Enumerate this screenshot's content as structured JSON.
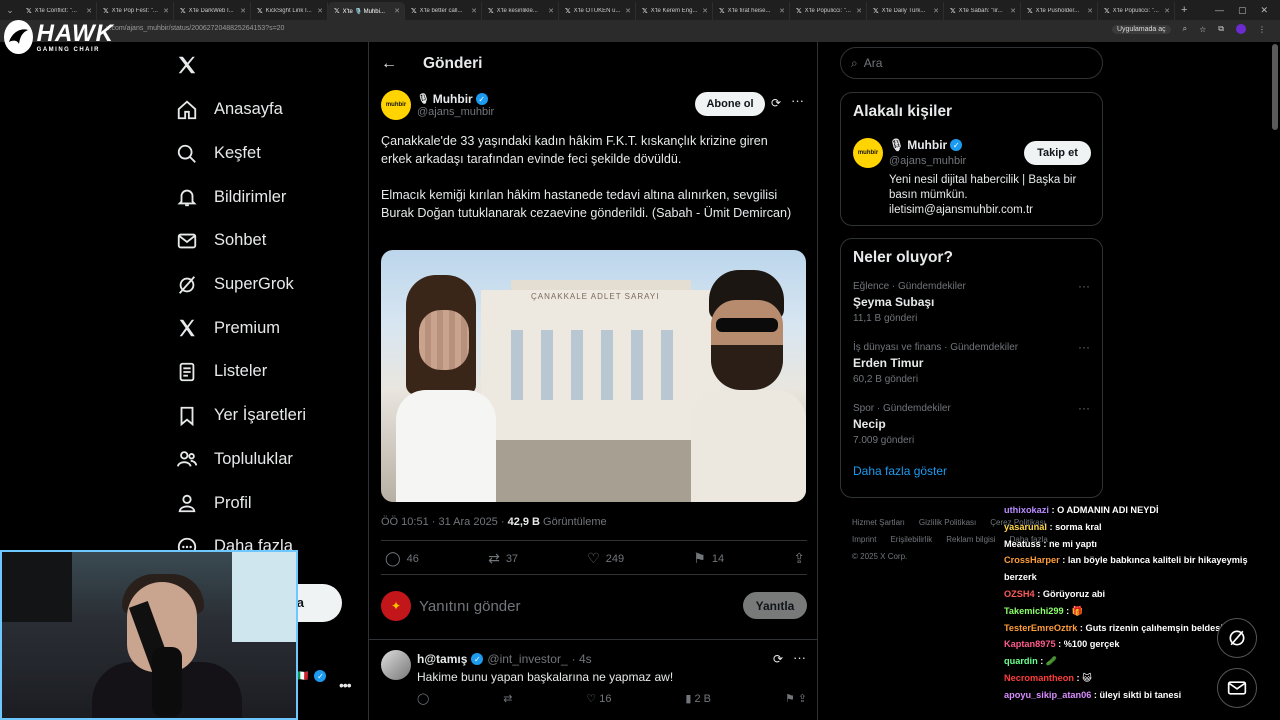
{
  "browser": {
    "tabs": [
      {
        "title": "X'te Conflict: \"..."
      },
      {
        "title": "X'te Pop Fest: \"..."
      },
      {
        "title": "X'te DarkWeb I..."
      },
      {
        "title": "KickSight Link I..."
      },
      {
        "title": "X'te 🎙️ Muhbi...",
        "active": true
      },
      {
        "title": "X'te better call..."
      },
      {
        "title": "X'te kesinlikle..."
      },
      {
        "title": "X'te OTUKEN u..."
      },
      {
        "title": "X'te Kerem Eng..."
      },
      {
        "title": "X'te firat heise..."
      },
      {
        "title": "X'te Populicci: \"..."
      },
      {
        "title": "X'te Daily Türk..."
      },
      {
        "title": "X'te Sabah: \"lir..."
      },
      {
        "title": "X'te Pusholder..."
      },
      {
        "title": "X'te Populicci: \"..."
      }
    ],
    "url": "x.com/ajans_muhbir/status/2006272048825264153?s=20",
    "app_pill": "Uygulamada aç",
    "accent": "#1d9bf0"
  },
  "overlay_logo": {
    "big": "HAWK",
    "small": "GAMING CHAIR"
  },
  "nav": {
    "items": [
      {
        "label": "Anasayfa",
        "icon": "home-icon"
      },
      {
        "label": "Keşfet",
        "icon": "search-icon"
      },
      {
        "label": "Bildirimler",
        "icon": "bell-icon"
      },
      {
        "label": "Sohbet",
        "icon": "mail-icon"
      },
      {
        "label": "SuperGrok",
        "icon": "grok-icon"
      },
      {
        "label": "Premium",
        "icon": "x-icon"
      },
      {
        "label": "Listeler",
        "icon": "list-icon"
      },
      {
        "label": "Yer İşaretleri",
        "icon": "bookmark-icon"
      },
      {
        "label": "Topluluklar",
        "icon": "people-icon"
      },
      {
        "label": "Profil",
        "icon": "person-icon"
      },
      {
        "label": "Daha fazla",
        "icon": "more-icon"
      }
    ],
    "post_button_partial": "a"
  },
  "header": {
    "title": "Gönderi"
  },
  "tweet": {
    "author_name": "Muhbir",
    "author_handle": "@ajans_muhbir",
    "avatar_text": "muhbir",
    "subscribe_label": "Abone ol",
    "text": "Çanakkale'de 33 yaşındaki kadın hâkim F.K.T. kıskançlık krizine giren erkek arkadaşı tarafından evinde feci şekilde dövüldü.\n\nElmacık kemiği kırılan hâkim hastanede tedavi altına alınırken, sevgilisi Burak Doğan tutuklanarak cezaevine gönderildi. (Sabah - Ümit Demircan)",
    "image_sign": "ÇANAKKALE ADLET SARAYI",
    "time": "ÖÖ 10:51 · 31 Ara 2025 · ",
    "views_value": "42,9 B",
    "views_label": " Görüntüleme",
    "counts": {
      "replies": "46",
      "reposts": "37",
      "likes": "249",
      "bookmarks": "14"
    }
  },
  "reply_box": {
    "placeholder": "Yanıtını gönder",
    "button": "Yanıtla"
  },
  "reply_tweet": {
    "name": "h@tamış",
    "handle": "@int_investor_",
    "time": "· 4s",
    "text": "Hakime bunu yapan başkalarına ne yapmaz aw!",
    "likes": "16",
    "views": "2 B"
  },
  "right": {
    "search_placeholder": "Ara",
    "related_title": "Alakalı kişiler",
    "related_person": {
      "name": "Muhbir",
      "handle": "@ajans_muhbir",
      "bio": "Yeni nesil dijital habercilik | Başka bir basın mümkün. iletisim@ajansmuhbir.com.tr",
      "follow_label": "Takip et"
    },
    "trends_title": "Neler oluyor?",
    "trends": [
      {
        "category": "Eğlence · Gündemdekiler",
        "name": "Şeyma Subaşı",
        "count": "11,1 B gönderi"
      },
      {
        "category": "İş dünyası ve finans · Gündemdekiler",
        "name": "Erden Timur",
        "count": "60,2 B gönderi"
      },
      {
        "category": "Spor · Gündemdekiler",
        "name": "Necip",
        "count": "7.009 gönderi"
      }
    ],
    "show_more": "Daha fazla göster",
    "footer": [
      "Hizmet Şartları",
      "Gizlilik Politikası",
      "Çerez Politikası",
      "Imprint",
      "Erişilebilirlik",
      "Reklam bilgisi",
      "Daha fazla ...",
      "© 2025 X Corp."
    ]
  },
  "chat": [
    {
      "user": "uthixokazi",
      "color": "#b98cff",
      "text": "O ADMANIN ADI NEYDİ"
    },
    {
      "user": "yasarunal",
      "color": "#ffd94a",
      "text": "sorma kral"
    },
    {
      "user": "Meatuss",
      "color": "#ffffff",
      "text": "ne mi yaptı"
    },
    {
      "user": "CrossHarper",
      "color": "#ff9d3b",
      "text": "lan böyle babkınca kaliteli bir hikayeymiş berzerk"
    },
    {
      "user": "OZSH4",
      "color": "#ff5a5a",
      "text": "Görüyoruz abi"
    },
    {
      "user": "Takemichi299",
      "color": "#8cff6a",
      "text": "🎁"
    },
    {
      "user": "TesterEmreOztrk",
      "color": "#ff9d3b",
      "text": "Guts rizenin çalıhemşin beldesinden"
    },
    {
      "user": "Kaptan8975",
      "color": "#ff5a8c",
      "text": "%100 gerçek"
    },
    {
      "user": "quardin",
      "color": "#6aff8c",
      "text": "🥒"
    },
    {
      "user": "Necromantheon",
      "color": "#ff3b3b",
      "text": "😺"
    },
    {
      "user": "apoyu_sikip_atan06",
      "color": "#d98cff",
      "text": "üleyi sikti bi tanesi"
    }
  ]
}
